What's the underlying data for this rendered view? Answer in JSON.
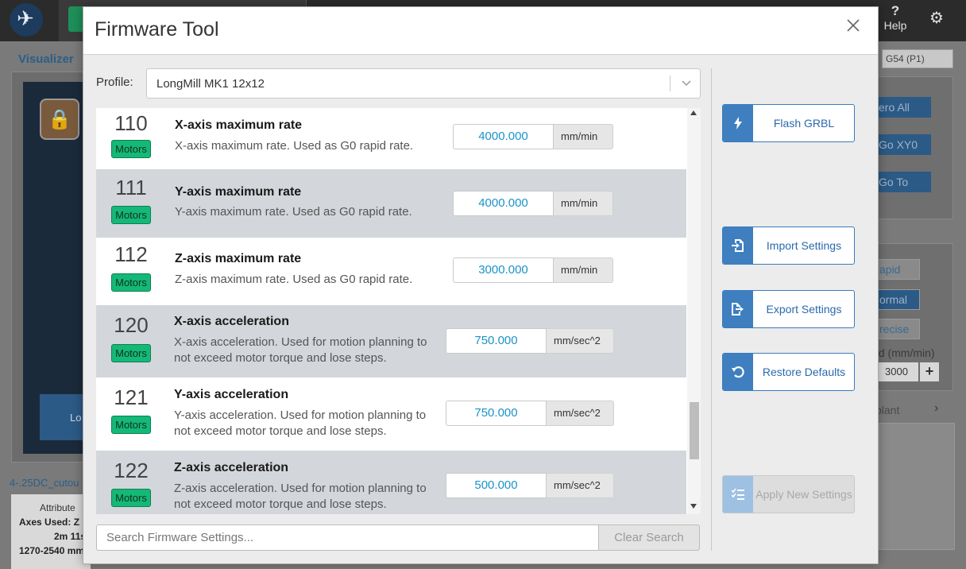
{
  "app": {
    "visualizer_label": "Visualizer",
    "unlock_label": "Lo",
    "file_name": "4-.25DC_cutou",
    "attributes_label": "Attribute",
    "axes_used": "Axes Used: Z",
    "duration": "2m 11s",
    "range": "1270-2540 mm",
    "help_label": "Help",
    "wcs_select": "G54 (P1)",
    "zero_all": "ero All",
    "go_xy0": "Go XY0",
    "go_to": "Go  To",
    "rapid": "apid",
    "normal": "ormal",
    "precise": "recise",
    "feed_label": "ed (mm/min)",
    "feed_value": "3000",
    "feed_plus": "+",
    "implant_label": "plant"
  },
  "modal": {
    "title": "Firmware Tool",
    "profile": {
      "label": "Profile:",
      "value": "LongMill MK1 12x12"
    },
    "settings": [
      {
        "num": "110",
        "badge": "Motors",
        "title": "X-axis maximum rate",
        "desc": "X-axis maximum rate. Used as G0 rapid rate.",
        "value": "4000.000",
        "unit": "mm/min"
      },
      {
        "num": "111",
        "badge": "Motors",
        "title": "Y-axis maximum rate",
        "desc": "Y-axis maximum rate. Used as G0 rapid rate.",
        "value": "4000.000",
        "unit": "mm/min"
      },
      {
        "num": "112",
        "badge": "Motors",
        "title": "Z-axis maximum rate",
        "desc": "Z-axis maximum rate. Used as G0 rapid rate.",
        "value": "3000.000",
        "unit": "mm/min"
      },
      {
        "num": "120",
        "badge": "Motors",
        "title": "X-axis acceleration",
        "desc": "X-axis acceleration. Used for motion planning to not exceed motor torque and lose steps.",
        "value": "750.000",
        "unit": "mm/sec^2"
      },
      {
        "num": "121",
        "badge": "Motors",
        "title": "Y-axis acceleration",
        "desc": "Y-axis acceleration. Used for motion planning to not exceed motor torque and lose steps.",
        "value": "750.000",
        "unit": "mm/sec^2"
      },
      {
        "num": "122",
        "badge": "Motors",
        "title": "Z-axis acceleration",
        "desc": "Z-axis acceleration. Used for motion planning to not exceed motor torque and lose steps.",
        "value": "500.000",
        "unit": "mm/sec^2"
      }
    ],
    "search": {
      "placeholder": "Search Firmware Settings...",
      "clear_label": "Clear Search"
    },
    "actions": {
      "flash": "Flash GRBL",
      "import": "Import Settings",
      "export": "Export Settings",
      "restore": "Restore Defaults",
      "apply": "Apply New Settings"
    },
    "colors": {
      "accent": "#3f7fc0",
      "badge": "#14b877",
      "value_text": "#1a93c8"
    }
  }
}
